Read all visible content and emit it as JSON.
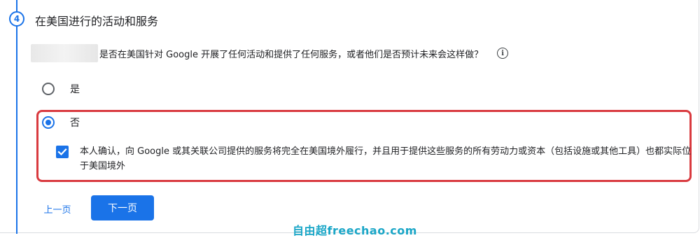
{
  "step": {
    "number": "4",
    "title": "在美国进行的活动和服务"
  },
  "question": {
    "text": "是否在美国针对 Google 开展了任何活动和提供了任何服务，或者他们是否预计未来会这样做？",
    "info_icon": "info-icon"
  },
  "options": [
    {
      "label": "是",
      "selected": false
    },
    {
      "label": "否",
      "selected": true
    }
  ],
  "confirmation": {
    "checked": true,
    "text": "本人确认，向 Google 或其关联公司提供的服务将完全在美国境外履行，并且用于提供这些服务的所有劳动力或资本（包括设施或其他工具）也都实际位于美国境外"
  },
  "buttons": {
    "prev_label": "上一页",
    "next_label": "下一页"
  },
  "watermark": "自由超freechao.com",
  "colors": {
    "accent": "#1a73e8",
    "highlight_border": "#d93a3f",
    "watermark": "#1aa6c7"
  }
}
